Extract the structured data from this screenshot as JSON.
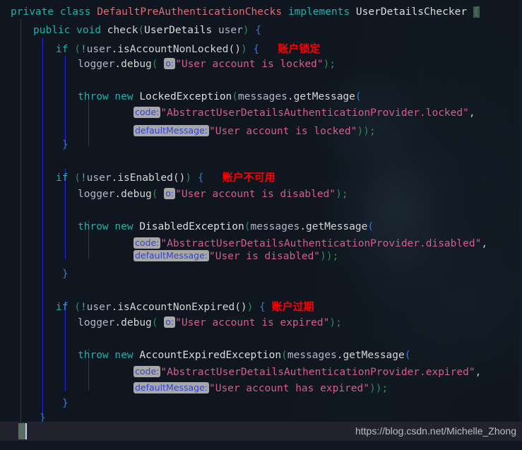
{
  "editor": {
    "background_color": "#0f1620",
    "indent_guide_color": "#2222dd",
    "annotation_color": "#ff0000",
    "string_color": "#d45c8f",
    "keyword_color": "#20b2aa",
    "hint_badge_bg": "#a8a8a8",
    "hint_badge_fg": "#3344cc"
  },
  "code": {
    "line1": {
      "kw_private": "private",
      "kw_class": "class",
      "class_name": "DefaultPreAuthenticationChecks",
      "kw_implements": "implements",
      "interface_name": "UserDetailsChecker",
      "open_brace": "{"
    },
    "line2": {
      "kw_public": "public",
      "kw_void": "void",
      "method": "check",
      "lparen": "(",
      "param_type": "UserDetails",
      "param_name": "user",
      "rparen": ")",
      "open_brace": "{"
    },
    "line3": {
      "kw_if": "if",
      "lparen": "(",
      "bang": "!",
      "receiver": "user",
      "dot": ".",
      "call": "isAccountNonLocked()",
      "rparen": ")",
      "open_brace": "{",
      "annotation": "账户锁定"
    },
    "line4": {
      "logger": "logger",
      "dot": ".",
      "method": "debug",
      "lparen": "(",
      "hint": "o:",
      "string": "\"User account is locked\"",
      "rparen": ")",
      "semi": ";"
    },
    "line6": {
      "kw_throw": "throw",
      "kw_new": "new",
      "exception": "LockedException",
      "lparen": "(",
      "receiver": "messages",
      "dot": ".",
      "call": "getMessage",
      "lparen2": "("
    },
    "line7": {
      "hint": "code:",
      "string": "\"AbstractUserDetailsAuthenticationProvider.locked\"",
      "comma": ","
    },
    "line8": {
      "hint": "defaultMessage:",
      "string": "\"User account is locked\"",
      "close": "))",
      "semi": ";"
    },
    "line9": {
      "close_brace": "}"
    },
    "line11": {
      "kw_if": "if",
      "lparen": "(",
      "bang": "!",
      "receiver": "user",
      "dot": ".",
      "call": "isEnabled()",
      "rparen": ")",
      "open_brace": "{",
      "annotation": "账户不可用"
    },
    "line12": {
      "logger": "logger",
      "dot": ".",
      "method": "debug",
      "lparen": "(",
      "hint": "o:",
      "string": "\"User account is disabled\"",
      "rparen": ")",
      "semi": ";"
    },
    "line14": {
      "kw_throw": "throw",
      "kw_new": "new",
      "exception": "DisabledException",
      "lparen": "(",
      "receiver": "messages",
      "dot": ".",
      "call": "getMessage",
      "lparen2": "("
    },
    "line15": {
      "hint": "code:",
      "string": "\"AbstractUserDetailsAuthenticationProvider.disabled\"",
      "comma": ","
    },
    "line16": {
      "hint": "defaultMessage:",
      "string": "\"User is disabled\"",
      "close": "))",
      "semi": ";"
    },
    "line17": {
      "close_brace": "}"
    },
    "line19": {
      "kw_if": "if",
      "lparen": "(",
      "bang": "!",
      "receiver": "user",
      "dot": ".",
      "call": "isAccountNonExpired()",
      "rparen": ")",
      "open_brace": "{",
      "annotation": "账户过期"
    },
    "line20": {
      "logger": "logger",
      "dot": ".",
      "method": "debug",
      "lparen": "(",
      "hint": "o:",
      "string": "\"User account is expired\"",
      "rparen": ")",
      "semi": ";"
    },
    "line22": {
      "kw_throw": "throw",
      "kw_new": "new",
      "exception": "AccountExpiredException",
      "lparen": "(",
      "receiver": "messages",
      "dot": ".",
      "call": "getMessage",
      "lparen2": "("
    },
    "line23": {
      "hint": "code:",
      "string": "\"AbstractUserDetailsAuthenticationProvider.expired\"",
      "comma": ","
    },
    "line24": {
      "hint": "defaultMessage:",
      "string": "\"User account has expired\"",
      "close": "))",
      "semi": ";"
    },
    "line25": {
      "close_brace": "}"
    },
    "line26": {
      "close_brace": "}"
    },
    "line27": {
      "close_brace": "}"
    }
  },
  "status_bar": {
    "watermark": "https://blog.csdn.net/Michelle_Zhong",
    "cursor_brace": "}"
  }
}
